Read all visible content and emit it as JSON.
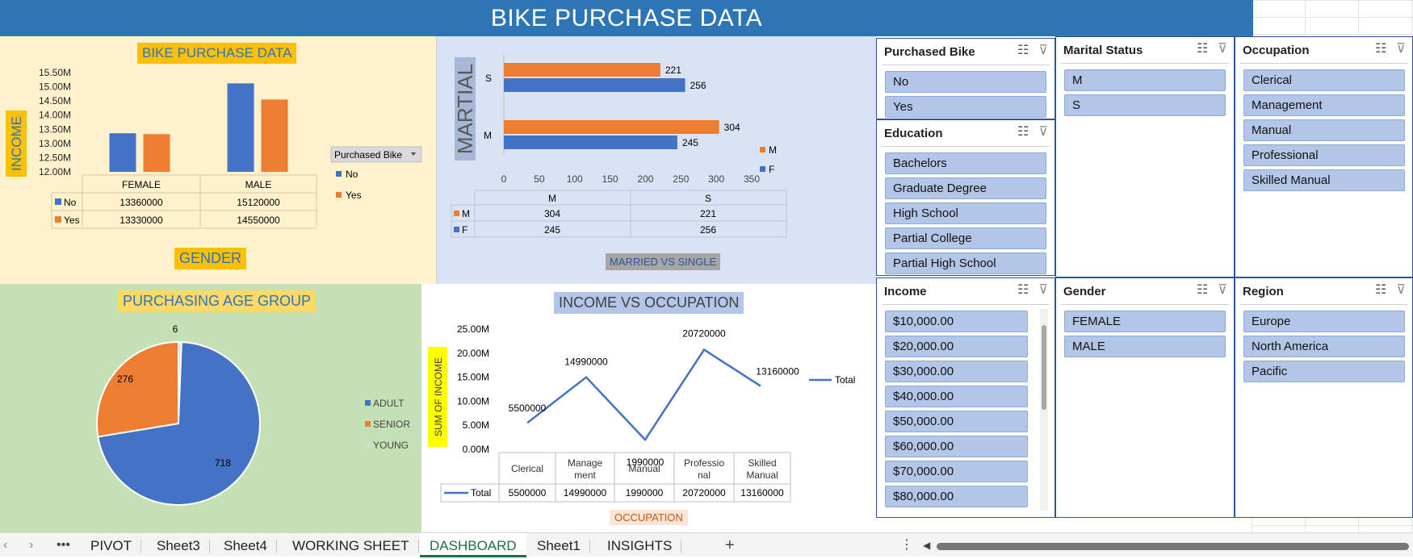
{
  "title": "BIKE PURCHASE DATA",
  "colors": {
    "blue": "#4472c4",
    "orange": "#ed7d31",
    "gray": "#d9d9d9"
  },
  "gender_chart": {
    "title": "BIKE PURCHASE DATA",
    "ylabel": "INCOME",
    "xlabel": "GENDER",
    "legend_title": "Purchased Bike",
    "legend": [
      "No",
      "Yes"
    ],
    "chart_data": {
      "type": "bar",
      "categories": [
        "FEMALE",
        "MALE"
      ],
      "series": [
        {
          "name": "No",
          "values": [
            13360000,
            15120000
          ]
        },
        {
          "name": "Yes",
          "values": [
            13330000,
            14550000
          ]
        }
      ],
      "ylim": [
        12000000,
        15500000
      ],
      "yticks": [
        "15.50M",
        "15.00M",
        "14.50M",
        "14.00M",
        "13.50M",
        "13.00M",
        "12.50M",
        "12.00M"
      ]
    },
    "table": {
      "headers": [
        "FEMALE",
        "MALE"
      ],
      "rows": [
        {
          "label": "No",
          "values": [
            "13360000",
            "15120000"
          ]
        },
        {
          "label": "Yes",
          "values": [
            "13330000",
            "14550000"
          ]
        }
      ]
    }
  },
  "marital_chart": {
    "ylabel": "MARTIAL",
    "xlabel": "MARRIED VS SINGLE",
    "chart_data": {
      "type": "bar",
      "orientation": "horizontal",
      "categories": [
        "S",
        "M"
      ],
      "series": [
        {
          "name": "M",
          "values": [
            221,
            304
          ]
        },
        {
          "name": "F",
          "values": [
            256,
            245
          ]
        }
      ],
      "xlim": [
        0,
        350
      ],
      "xticks": [
        "0",
        "50",
        "100",
        "150",
        "200",
        "250",
        "300",
        "350"
      ]
    },
    "table": {
      "headers": [
        "M",
        "S"
      ],
      "rows": [
        {
          "label": "M",
          "values": [
            "304",
            "221"
          ]
        },
        {
          "label": "F",
          "values": [
            "245",
            "256"
          ]
        }
      ]
    }
  },
  "age_chart": {
    "title": "PURCHASING AGE GROUP",
    "legend": [
      "ADULT",
      "SENIOR",
      "YOUNG"
    ],
    "chart_data": {
      "type": "pie",
      "categories": [
        "ADULT",
        "SENIOR",
        "YOUNG"
      ],
      "values": [
        718,
        276,
        6
      ]
    }
  },
  "occupation_chart": {
    "title": "INCOME VS OCCUPATION",
    "ylabel": "SUM OF INCOME",
    "xlabel": "OCCUPATION",
    "legend": "Total",
    "chart_data": {
      "type": "line",
      "categories": [
        "Clerical",
        "Management",
        "Manual",
        "Professional",
        "Skilled Manual"
      ],
      "series": [
        {
          "name": "Total",
          "values": [
            5500000,
            14990000,
            1990000,
            20720000,
            13160000
          ]
        }
      ],
      "ylim": [
        0,
        25000000
      ],
      "yticks": [
        "25.00M",
        "20.00M",
        "15.00M",
        "10.00M",
        "5.00M",
        "0.00M"
      ]
    },
    "table": {
      "headers": [
        "Clerical",
        "Manage ment",
        "Manual",
        "Professio nal",
        "Skilled Manual"
      ],
      "row_label": "Total",
      "values": [
        "5500000",
        "14990000",
        "1990000",
        "20720000",
        "13160000"
      ]
    }
  },
  "slicers": {
    "purchased_bike": {
      "title": "Purchased Bike",
      "items": [
        "No",
        "Yes"
      ]
    },
    "marital_status": {
      "title": "Marital Status",
      "items": [
        "M",
        "S"
      ]
    },
    "occupation": {
      "title": "Occupation",
      "items": [
        "Clerical",
        "Management",
        "Manual",
        "Professional",
        "Skilled Manual"
      ]
    },
    "education": {
      "title": "Education",
      "items": [
        "Bachelors",
        "Graduate Degree",
        "High School",
        "Partial College",
        "Partial High School"
      ]
    },
    "income": {
      "title": "Income",
      "items": [
        "$10,000.00",
        "$20,000.00",
        "$30,000.00",
        "$40,000.00",
        "$50,000.00",
        "$60,000.00",
        "$70,000.00",
        "$80,000.00"
      ]
    },
    "gender": {
      "title": "Gender",
      "items": [
        "FEMALE",
        "MALE"
      ]
    },
    "region": {
      "title": "Region",
      "items": [
        "Europe",
        "North America",
        "Pacific"
      ]
    }
  },
  "tabs": {
    "nav": [
      "‹",
      "›",
      "•••"
    ],
    "items": [
      "PIVOT",
      "Sheet3",
      "Sheet4",
      "WORKING SHEET",
      "DASHBOARD",
      "Sheet1",
      "INSIGHTS"
    ],
    "active": "DASHBOARD",
    "add": "+",
    "more": "⋮"
  }
}
